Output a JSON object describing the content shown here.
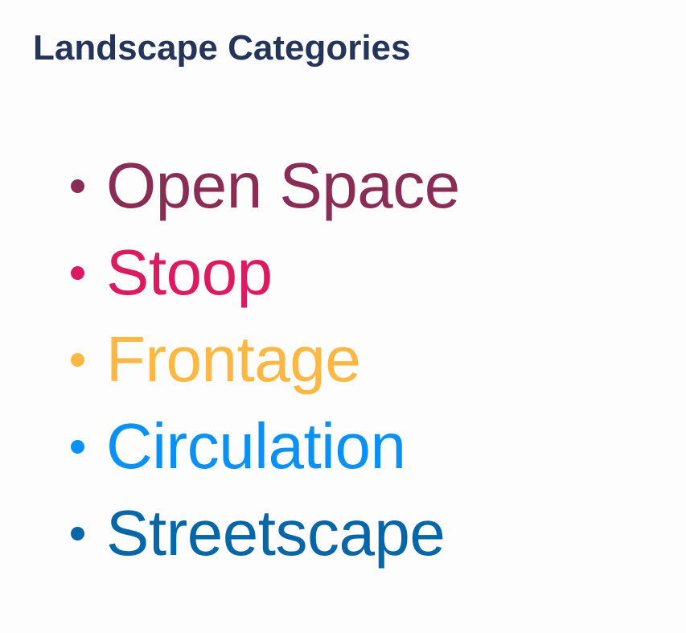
{
  "title": "Landscape Categories",
  "categories": [
    {
      "label": "Open Space",
      "color": "#8a2d55"
    },
    {
      "label": "Stoop",
      "color": "#db1a5f"
    },
    {
      "label": "Frontage",
      "color": "#fdb743"
    },
    {
      "label": "Circulation",
      "color": "#0b91f3"
    },
    {
      "label": "Streetscape",
      "color": "#0566a8"
    }
  ]
}
